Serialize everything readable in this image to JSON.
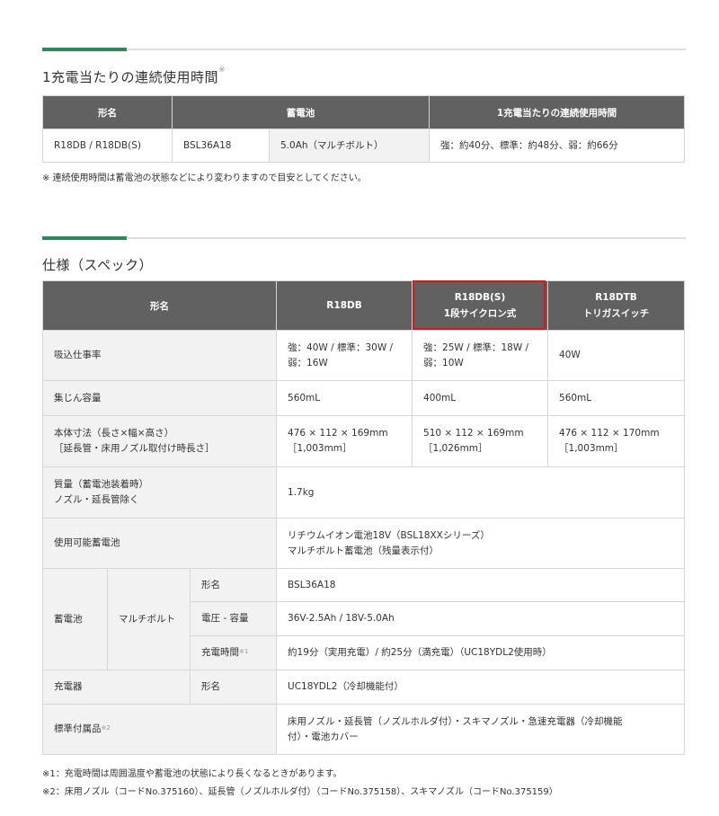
{
  "section1": {
    "heading": "1充電当たりの連続使用時間",
    "heading_mark": "※",
    "headers": [
      "形名",
      "蓄電池",
      "1充電当たりの連続使用時間"
    ],
    "row": [
      "R18DB / R18DB(S)",
      "BSL36A18",
      "5.0Ah（マルチボルト）",
      "強：約40分、標準：約48分、弱：約66分"
    ],
    "note": "※ 連続使用時間は蓄電池の状態などにより変わりますので目安としてください。"
  },
  "section2": {
    "heading": "仕様（スペック）",
    "headers": {
      "model": "形名",
      "col1": "R18DB",
      "col2_line1": "R18DB(S)",
      "col2_line2": "1段サイクロン式",
      "col3_line1": "R18DTB",
      "col3_line2": "トリガスイッチ"
    },
    "rows": {
      "suction": {
        "label": "吸込仕事率",
        "v1_line1": "強：40W / 標準：30W /",
        "v1_line2": "弱：16W",
        "v2_line1": "強：25W / 標準：18W /",
        "v2_line2": "弱：10W",
        "v3": "40W"
      },
      "dust": {
        "label": "集じん容量",
        "v1": "560mL",
        "v2": "400mL",
        "v3": "560mL"
      },
      "size": {
        "label_line1": "本体寸法（長さ×幅×高さ）",
        "label_line2": "［延長管・床用ノズル取付け時長さ］",
        "v1_line1": "476 × 112 × 169mm",
        "v1_line2": "［1,003mm］",
        "v2_line1": "510 × 112 × 169mm",
        "v2_line2": "［1,026mm］",
        "v3_line1": "476 × 112 × 170mm",
        "v3_line2": "［1,003mm］"
      },
      "mass": {
        "label_line1": "質量（蓄電池装着時）",
        "label_line2": "ノズル・延長管除く",
        "value": "1.7kg"
      },
      "battery_usable": {
        "label": "使用可能蓄電池",
        "value_line1": "リチウムイオン電池18V（BSL18XXシリーズ）",
        "value_line2": "マルチボルト蓄電池（残量表示付）"
      },
      "battery": {
        "label": "蓄電池",
        "sub_label": "マルチボルト",
        "model_label": "形名",
        "model_value": "BSL36A18",
        "voltage_label": "電圧 - 容量",
        "voltage_value": "36V-2.5Ah / 18V-5.0Ah",
        "charge_label": "充電時間",
        "charge_mark": "※1",
        "charge_value": "約19分（実用充電）/ 約25分（満充電）（UC18YDL2使用時）"
      },
      "charger": {
        "label": "充電器",
        "sub_label": "形名",
        "value": "UC18YDL2（冷却機能付）"
      },
      "accessories": {
        "label": "標準付属品",
        "mark": "※2",
        "value_line1": "床用ノズル・延長管（ノズルホルダ付）・スキマノズル・急速充電器（冷却機能",
        "value_line2": "付）・電池カバー"
      }
    },
    "footnotes": [
      "※1：充電時間は周囲温度や蓄電池の状態により長くなるときがあります。",
      "※2：床用ノズル（コードNo.375160）、延長管（ノズルホルダ付）（コードNo.375158）、スキマノズル（コードNo.375159）"
    ]
  },
  "colors": {
    "accent": "#2a8a5c",
    "header_bg": "#616161",
    "label_bg": "#f2f2f2",
    "highlight": "#d9161c"
  }
}
